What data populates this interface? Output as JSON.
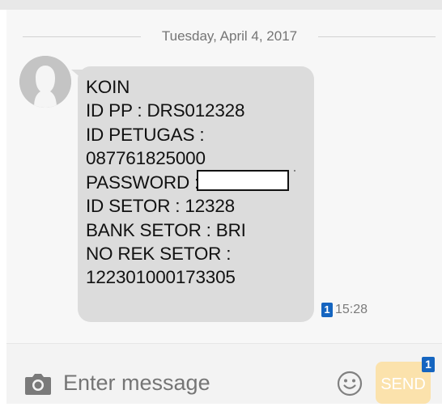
{
  "conversation": {
    "date_separator": "Tuesday, April 4, 2017"
  },
  "message": {
    "lines": [
      "KOIN",
      "ID PP : DRS012328",
      "ID PETUGAS :",
      "087761825000",
      "PASSWORD   :",
      "ID SETOR   : 12328",
      "BANK SETOR   : BRI",
      "NO REK SETOR :",
      "122301000173305"
    ],
    "sim": "1",
    "time": "15:28",
    "bubble_color": "#dcdcdc"
  },
  "composer": {
    "placeholder": "Enter message",
    "send_label": "SEND",
    "send_sim": "1",
    "send_color": "#fbe2ac",
    "sim_badge_color": "#1565c0"
  },
  "icons": {
    "avatar": "person-silhouette-icon",
    "attach": "camera-icon",
    "emoji": "smiley-icon"
  }
}
